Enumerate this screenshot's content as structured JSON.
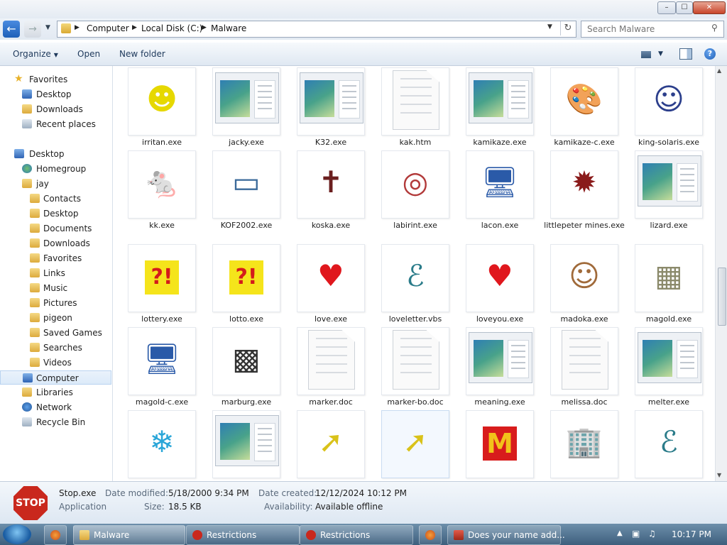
{
  "window": {
    "controls": {
      "minimize": "–",
      "maximize": "☐",
      "close": "✕"
    }
  },
  "address": {
    "crumbs": [
      "Computer",
      "Local Disk (C:)",
      "Malware"
    ]
  },
  "search": {
    "placeholder": "Search Malware"
  },
  "toolbar": {
    "organize": "Organize",
    "open": "Open",
    "new_folder": "New folder"
  },
  "sidebar": {
    "favorites": "Favorites",
    "fav_items": [
      "Desktop",
      "Downloads",
      "Recent places"
    ],
    "desktop": "Desktop",
    "homegroup": "Homegroup",
    "user": "jay",
    "user_items": [
      "Contacts",
      "Desktop",
      "Documents",
      "Downloads",
      "Favorites",
      "Links",
      "Music",
      "Pictures",
      "pigeon",
      "Saved Games",
      "Searches",
      "Videos"
    ],
    "computer": "Computer",
    "libraries": "Libraries",
    "network": "Network",
    "recycle": "Recycle Bin"
  },
  "files": [
    {
      "name": "irritan.exe",
      "icon": "smiley-icon"
    },
    {
      "name": "jacky.exe",
      "icon": "preview-thumbnail"
    },
    {
      "name": "K32.exe",
      "icon": "preview-thumbnail"
    },
    {
      "name": "kak.htm",
      "icon": "blank-document-icon"
    },
    {
      "name": "kamikaze.exe",
      "icon": "preview-thumbnail"
    },
    {
      "name": "kamikaze-c.exe",
      "icon": "paint-palette-icon"
    },
    {
      "name": "king-solaris.exe",
      "icon": "anime-girl-icon"
    },
    {
      "name": "kk.exe",
      "icon": "mouse-icon"
    },
    {
      "name": "KOF2002.exe",
      "icon": "window-icon"
    },
    {
      "name": "koska.exe",
      "icon": "coffin-icon"
    },
    {
      "name": "labirint.exe",
      "icon": "maze-icon"
    },
    {
      "name": "lacon.exe",
      "icon": "computer-setup-icon"
    },
    {
      "name": "littlepeter mines.exe",
      "icon": "mine-icon"
    },
    {
      "name": "lizard.exe",
      "icon": "preview-thumbnail"
    },
    {
      "name": "lottery.exe",
      "icon": "exclamation-icon"
    },
    {
      "name": "lotto.exe",
      "icon": "exclamation-icon"
    },
    {
      "name": "love.exe",
      "icon": "heart-icon"
    },
    {
      "name": "loveletter.vbs",
      "icon": "script-icon"
    },
    {
      "name": "loveyou.exe",
      "icon": "heart-icon"
    },
    {
      "name": "madoka.exe",
      "icon": "girl-icon"
    },
    {
      "name": "magold.exe",
      "icon": "photo-icon"
    },
    {
      "name": "magold-c.exe",
      "icon": "computer-setup-icon"
    },
    {
      "name": "marburg.exe",
      "icon": "monitor-icon"
    },
    {
      "name": "marker.doc",
      "icon": "blank-document-icon"
    },
    {
      "name": "marker-bo.doc",
      "icon": "blank-document-icon"
    },
    {
      "name": "meaning.exe",
      "icon": "preview-thumbnail"
    },
    {
      "name": "melissa.doc",
      "icon": "blank-document-icon"
    },
    {
      "name": "melter.exe",
      "icon": "preview-thumbnail"
    },
    {
      "name": "",
      "icon": "snowflake-icon"
    },
    {
      "name": "",
      "icon": "preview-thumbnail"
    },
    {
      "name": "",
      "icon": "shortcut-icon"
    },
    {
      "name": "",
      "icon": "shortcut-icon"
    },
    {
      "name": "",
      "icon": "mcdonalds-icon"
    },
    {
      "name": "",
      "icon": "buildings-icon"
    },
    {
      "name": "",
      "icon": "script-icon"
    }
  ],
  "details": {
    "icon_text": "STOP",
    "filename": "Stop.exe",
    "type": "Application",
    "modified_label": "Date modified:",
    "modified_value": "5/18/2000 9:34 PM",
    "size_label": "Size:",
    "size_value": "18.5 KB",
    "created_label": "Date created:",
    "created_value": "12/12/2024 10:12 PM",
    "avail_label": "Availability:",
    "avail_value": "Available offline"
  },
  "taskbar": {
    "items": [
      "Malware",
      "Restrictions",
      "Restrictions",
      "Does your name add..."
    ],
    "clock": "10:17 PM"
  }
}
